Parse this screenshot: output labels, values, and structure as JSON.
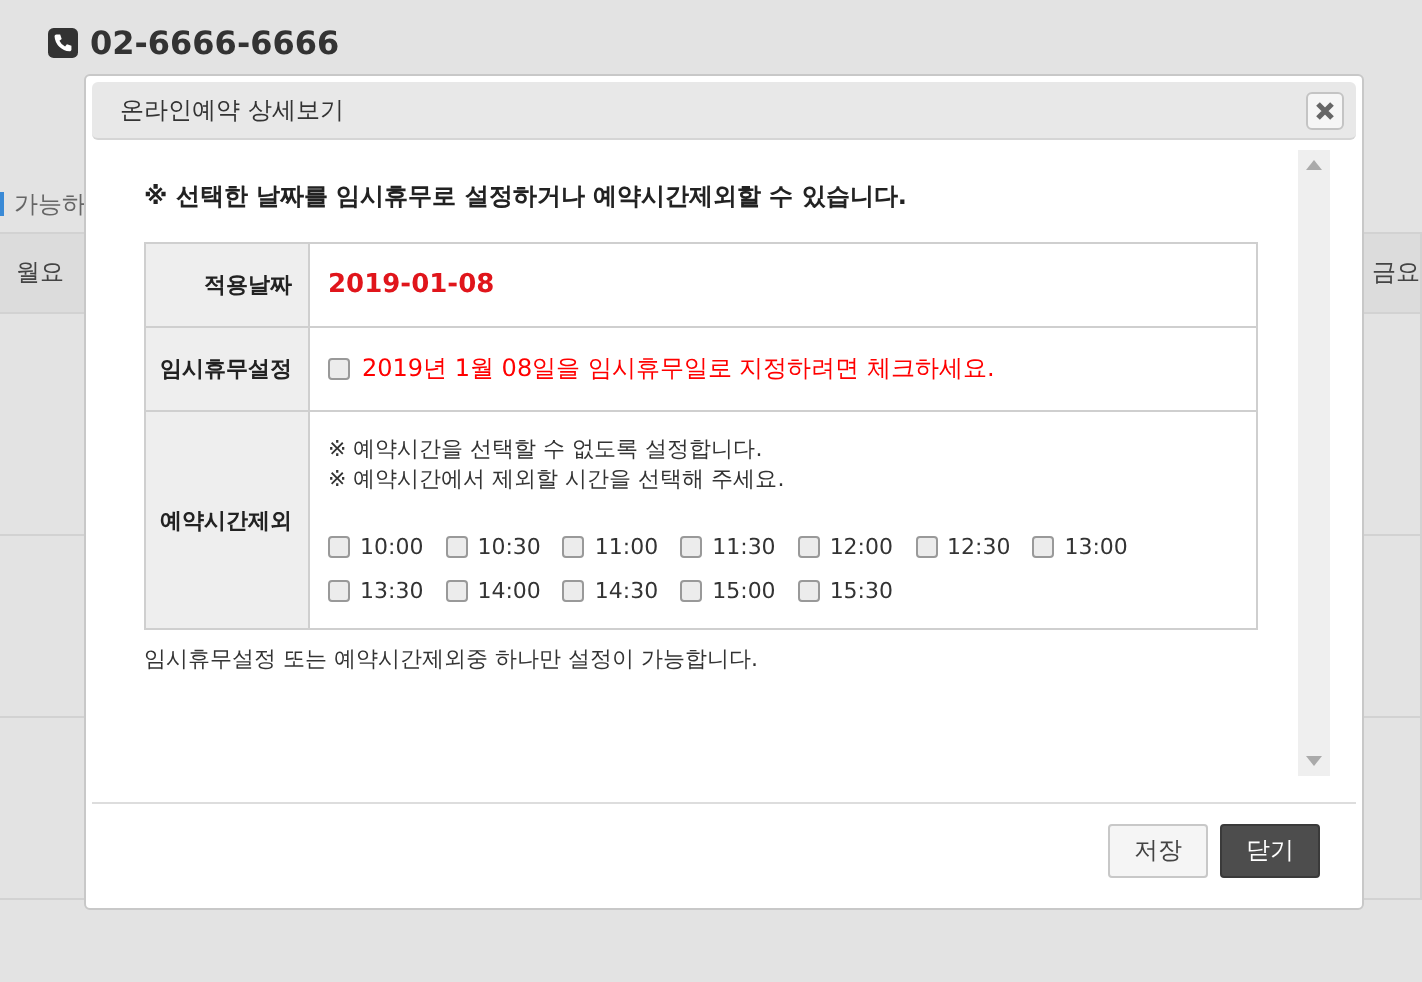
{
  "background": {
    "phone": "02-6666-6666",
    "legend": "가능하",
    "day_headers": [
      "월요",
      "금요"
    ]
  },
  "dialog": {
    "title": "온라인예약 상세보기",
    "notice": "※ 선택한 날짜를 임시휴무로 설정하거나 예약시간제외할 수 있습니다.",
    "rows": [
      {
        "kind": "date",
        "label": "적용날짜",
        "value": "2019-01-08"
      },
      {
        "kind": "holiday",
        "label": "임시휴무설정",
        "checked": false,
        "text": "2019년 1월 08일을 임시휴무일로 지정하려면 체크하세요."
      },
      {
        "kind": "times",
        "label": "예약시간제외",
        "notes": [
          "※ 예약시간을 선택할 수 없도록 설정합니다.",
          "※ 예약시간에서 제외할 시간을 선택해 주세요."
        ],
        "times": [
          {
            "label": "10:00",
            "checked": false
          },
          {
            "label": "10:30",
            "checked": false
          },
          {
            "label": "11:00",
            "checked": false
          },
          {
            "label": "11:30",
            "checked": false
          },
          {
            "label": "12:00",
            "checked": false
          },
          {
            "label": "12:30",
            "checked": false
          },
          {
            "label": "13:00",
            "checked": false
          },
          {
            "label": "13:30",
            "checked": false
          },
          {
            "label": "14:00",
            "checked": false
          },
          {
            "label": "14:30",
            "checked": false
          },
          {
            "label": "15:00",
            "checked": false
          },
          {
            "label": "15:30",
            "checked": false
          }
        ]
      }
    ],
    "footnote": "임시휴무설정 또는 예약시간제외중 하나만 설정이 가능합니다.",
    "buttons": [
      {
        "label": "저장",
        "kind": "secondary"
      },
      {
        "label": "닫기",
        "kind": "primary"
      }
    ]
  }
}
